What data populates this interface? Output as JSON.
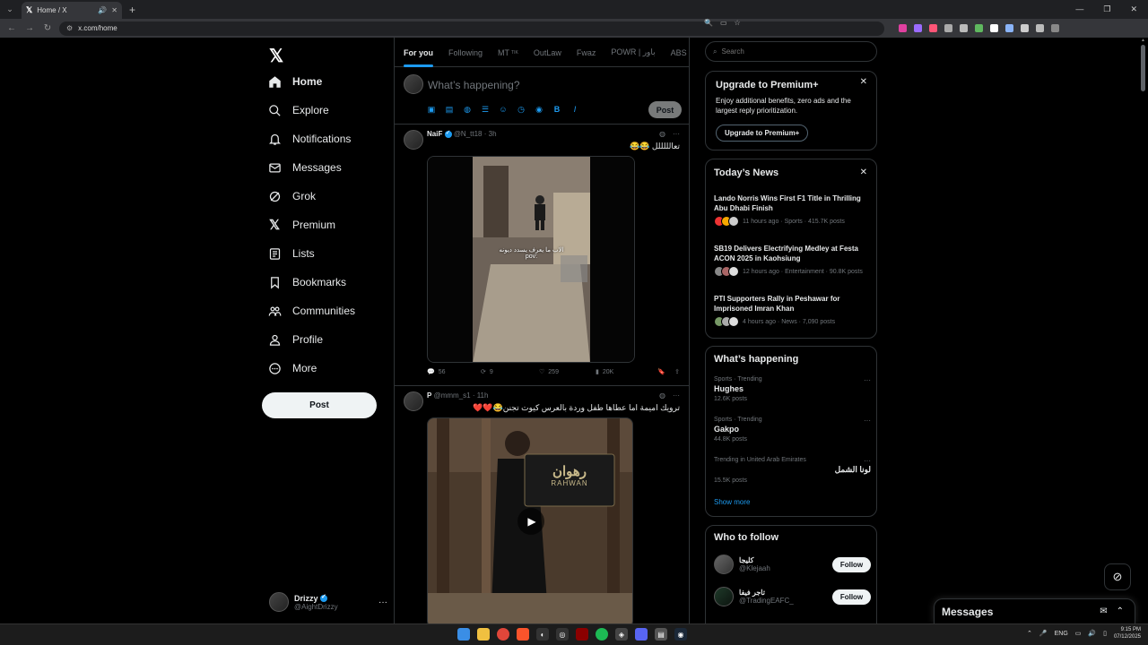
{
  "browser": {
    "tab_title": "Home / X",
    "url": "x.com/home",
    "extension_colors": [
      "#e040a0",
      "#9b6bff",
      "#ff5577",
      "#aaaaaa",
      "#bbbbbb",
      "#5fb85f",
      "#ffffff",
      "#8ab4f8",
      "#cccccc",
      "#bbbbbb",
      "#888888"
    ]
  },
  "nav": {
    "items": [
      {
        "label": "Home",
        "icon": "home-icon"
      },
      {
        "label": "Explore",
        "icon": "search-icon"
      },
      {
        "label": "Notifications",
        "icon": "bell-icon"
      },
      {
        "label": "Messages",
        "icon": "mail-icon"
      },
      {
        "label": "Grok",
        "icon": "grok-icon"
      },
      {
        "label": "Premium",
        "icon": "x-icon"
      },
      {
        "label": "Lists",
        "icon": "list-icon"
      },
      {
        "label": "Bookmarks",
        "icon": "bookmark-icon"
      },
      {
        "label": "Communities",
        "icon": "people-icon"
      },
      {
        "label": "Profile",
        "icon": "person-icon"
      },
      {
        "label": "More",
        "icon": "more-circle-icon"
      }
    ],
    "post_label": "Post",
    "account": {
      "name": "Drizzy",
      "handle": "@AightDrizzy"
    }
  },
  "feed": {
    "tabs": [
      {
        "label": "For you",
        "badge": ""
      },
      {
        "label": "Following",
        "badge": ""
      },
      {
        "label": "MT",
        "badge": "TIK"
      },
      {
        "label": "OutLaw",
        "badge": ""
      },
      {
        "label": "Fwaz",
        "badge": ""
      },
      {
        "label": "POWR | باور",
        "badge": ""
      },
      {
        "label": "ABS",
        "badge": ""
      }
    ],
    "compose_placeholder": "What’s happening?",
    "compose_post_label": "Post",
    "tweets": [
      {
        "name": "NaiF",
        "handle": "@N_tt18",
        "time": "3h",
        "text": "تعالللللل 😂😂",
        "video_caption_1": "الاب ما يعرف يسدد ديونه",
        "video_caption_2": "pov:",
        "replies": "56",
        "reposts": "9",
        "likes": "259",
        "views": "20K"
      },
      {
        "name": "P",
        "handle": "@mmm_s1",
        "time": "11h",
        "text": "ترويك اميمة اما عطاها طفل وردة بالعرس كيوت تجنن😂❤️❤️",
        "sign_text": "رهوان",
        "sign_subtext": "RAHWAN"
      }
    ]
  },
  "sidebar": {
    "search_placeholder": "Search",
    "premium": {
      "title": "Upgrade to Premium+",
      "body": "Enjoy additional benefits, zero ads and the largest reply prioritization.",
      "button": "Upgrade to Premium+"
    },
    "news": {
      "title": "Today’s News",
      "items": [
        {
          "headline": "Lando Norris Wins First F1 Title in Thrilling Abu Dhabi Finish",
          "meta": "11 hours ago · Sports · 415.7K posts"
        },
        {
          "headline": "SB19 Delivers Electrifying Medley at Festa ACON 2025 in Kaohsiung",
          "meta": "12 hours ago · Entertainment · 90.8K posts"
        },
        {
          "headline": "PTI Supporters Rally in Peshawar for Imprisoned Imran Khan",
          "meta": "4 hours ago · News · 7,090 posts"
        }
      ]
    },
    "happening": {
      "title": "What’s happening",
      "trends": [
        {
          "category": "Sports · Trending",
          "name": "Hughes",
          "count": "12.6K posts"
        },
        {
          "category": "Sports · Trending",
          "name": "Gakpo",
          "count": "44.8K posts"
        },
        {
          "category": "Trending in United Arab Emirates",
          "name": "لونا الشمل",
          "count": "15.5K posts"
        }
      ],
      "show_more": "Show more"
    },
    "who_to_follow": {
      "title": "Who to follow",
      "people": [
        {
          "name": "كليجا",
          "handle": "@Klejaah",
          "button": "Follow"
        },
        {
          "name": "تاجر فيفا",
          "handle": "@TradingEAFC_",
          "button": "Follow"
        }
      ]
    }
  },
  "messages_drawer": {
    "title": "Messages"
  },
  "taskbar": {
    "lang": "ENG",
    "time": "9:15 PM",
    "date": "07/12/2025"
  }
}
